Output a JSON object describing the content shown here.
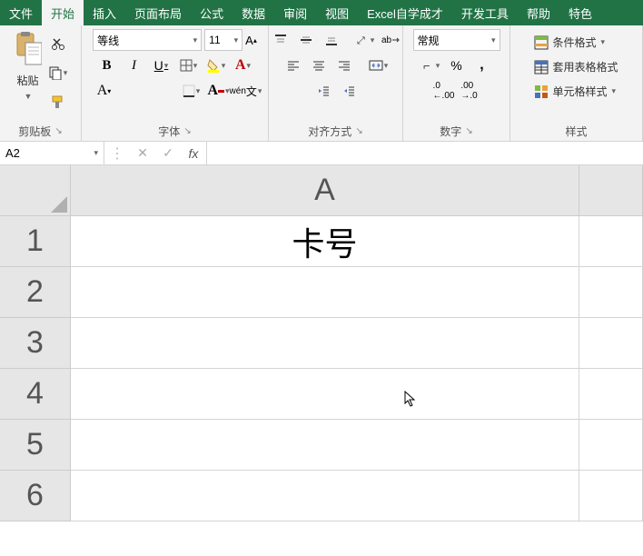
{
  "tabs": [
    "文件",
    "开始",
    "插入",
    "页面布局",
    "公式",
    "数据",
    "审阅",
    "视图",
    "Excel自学成才",
    "开发工具",
    "帮助",
    "特色"
  ],
  "active_tab_index": 1,
  "clipboard": {
    "paste_label": "粘贴",
    "group_label": "剪贴板"
  },
  "font": {
    "name": "等线",
    "size": "11",
    "bold": "B",
    "italic": "I",
    "underline": "U",
    "group_label": "字体",
    "wen_label": "wén"
  },
  "align": {
    "wrap_symbol": "ab",
    "group_label": "对齐方式"
  },
  "number": {
    "format": "常规",
    "group_label": "数字"
  },
  "styles": {
    "cond": "条件格式",
    "tbl": "套用表格格式",
    "cell": "单元格样式",
    "group_label": "样式"
  },
  "namebox": "A2",
  "fx_label": "fx",
  "formula": "",
  "columns": [
    "A"
  ],
  "rows": [
    "1",
    "2",
    "3",
    "4",
    "5",
    "6"
  ],
  "cells": {
    "A1": "卡号"
  }
}
